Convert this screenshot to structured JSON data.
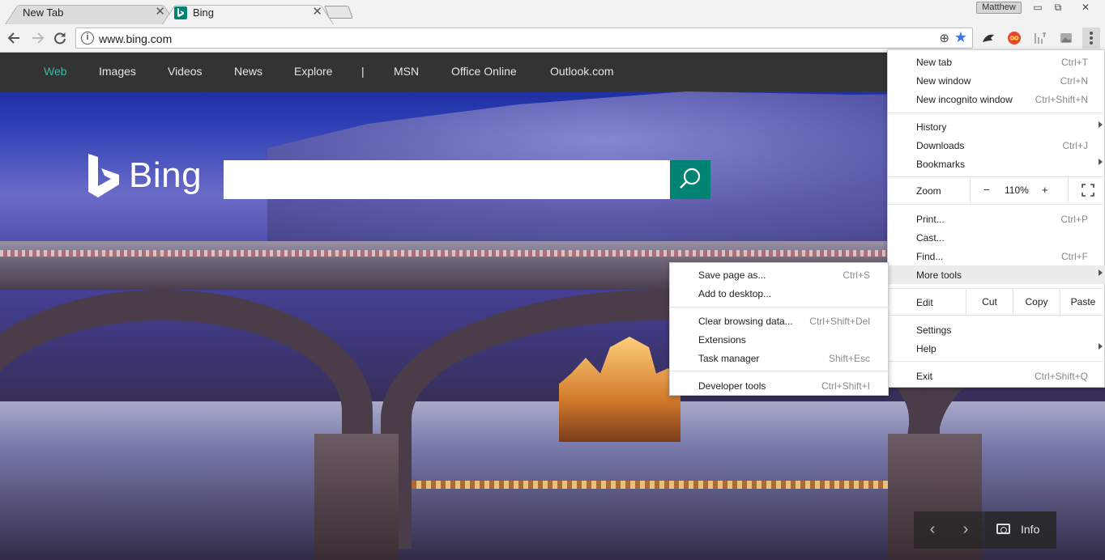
{
  "tabs": [
    {
      "title": "New Tab",
      "close": "✕"
    },
    {
      "title": "Bing",
      "close": "✕"
    }
  ],
  "window": {
    "profile": "Matthew",
    "minimize": "▭",
    "restore": "⧉",
    "close": "✕"
  },
  "toolbar": {
    "back_icon": "arrow-left-icon",
    "forward_icon": "arrow-right-icon",
    "reload_icon": "reload-icon",
    "url": "www.bing.com",
    "info_glyph": "i",
    "zoom_glyph": "⊕",
    "star_glyph": "★"
  },
  "bing": {
    "nav": [
      "Web",
      "Images",
      "Videos",
      "News",
      "Explore",
      "|",
      "MSN",
      "Office Online",
      "Outlook.com"
    ],
    "logo_text": "Bing",
    "search_value": "",
    "carousel": {
      "prev": "‹",
      "next": "›",
      "info": "Info"
    }
  },
  "menu": {
    "items": [
      {
        "label": "New tab",
        "shortcut": "Ctrl+T"
      },
      {
        "label": "New window",
        "shortcut": "Ctrl+N"
      },
      {
        "label": "New incognito window",
        "shortcut": "Ctrl+Shift+N"
      },
      {
        "label": "History",
        "shortcut": ""
      },
      {
        "label": "Downloads",
        "shortcut": "Ctrl+J"
      },
      {
        "label": "Bookmarks",
        "shortcut": ""
      },
      {
        "label": "Print...",
        "shortcut": "Ctrl+P"
      },
      {
        "label": "Cast...",
        "shortcut": ""
      },
      {
        "label": "Find...",
        "shortcut": "Ctrl+F"
      },
      {
        "label": "More tools",
        "shortcut": ""
      },
      {
        "label": "Settings",
        "shortcut": ""
      },
      {
        "label": "Help",
        "shortcut": ""
      },
      {
        "label": "Exit",
        "shortcut": "Ctrl+Shift+Q"
      }
    ],
    "zoom": {
      "label": "Zoom",
      "minus": "−",
      "value": "110%",
      "plus": "+"
    },
    "edit": {
      "label": "Edit",
      "cut": "Cut",
      "copy": "Copy",
      "paste": "Paste"
    }
  },
  "more_tools": {
    "items": [
      {
        "label": "Save page as...",
        "shortcut": "Ctrl+S"
      },
      {
        "label": "Add to desktop...",
        "shortcut": ""
      },
      {
        "label": "Clear browsing data...",
        "shortcut": "Ctrl+Shift+Del"
      },
      {
        "label": "Extensions",
        "shortcut": ""
      },
      {
        "label": "Task manager",
        "shortcut": "Shift+Esc"
      },
      {
        "label": "Developer tools",
        "shortcut": "Ctrl+Shift+I"
      }
    ]
  },
  "colors": {
    "bing_teal": "#008373",
    "nav_active": "#3fb5a6",
    "star_blue": "#3b78e7"
  }
}
